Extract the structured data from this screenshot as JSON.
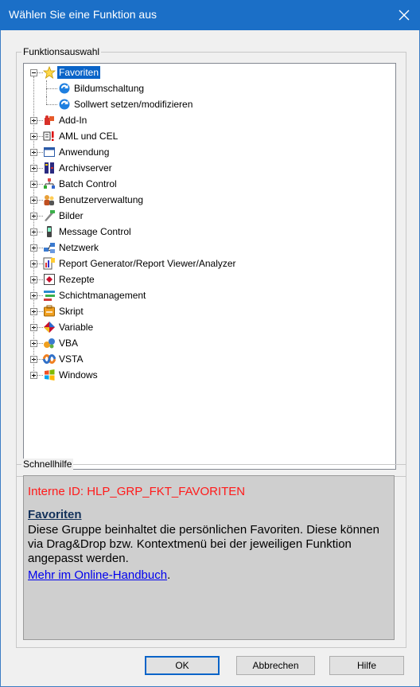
{
  "window": {
    "title": "Wählen Sie eine Funktion aus",
    "close_glyph": "✕"
  },
  "function_group": {
    "legend": "Funktionsauswahl",
    "tree": [
      {
        "label": "Favoriten",
        "icon": "star-icon",
        "expander": "minus",
        "selected": true,
        "level": 0
      },
      {
        "label": "Bildumschaltung",
        "icon": "function-icon",
        "level": 1
      },
      {
        "label": "Sollwert setzen/modifizieren",
        "icon": "function-icon",
        "level": 1
      },
      {
        "label": "Add-In",
        "icon": "puzzle-icon",
        "expander": "plus",
        "level": 0
      },
      {
        "label": "AML und CEL",
        "icon": "alarm-list-icon",
        "expander": "plus",
        "level": 0
      },
      {
        "label": "Anwendung",
        "icon": "window-icon",
        "expander": "plus",
        "level": 0
      },
      {
        "label": "Archivserver",
        "icon": "archive-server-icon",
        "expander": "plus",
        "level": 0
      },
      {
        "label": "Batch Control",
        "icon": "batch-control-icon",
        "expander": "plus",
        "level": 0
      },
      {
        "label": "Benutzerverwaltung",
        "icon": "users-icon",
        "expander": "plus",
        "level": 0
      },
      {
        "label": "Bilder",
        "icon": "pictures-icon",
        "expander": "plus",
        "level": 0
      },
      {
        "label": "Message Control",
        "icon": "phone-icon",
        "expander": "plus",
        "level": 0
      },
      {
        "label": "Netzwerk",
        "icon": "network-icon",
        "expander": "plus",
        "level": 0
      },
      {
        "label": "Report Generator/Report Viewer/Analyzer",
        "icon": "report-icon",
        "expander": "plus",
        "level": 0
      },
      {
        "label": "Rezepte",
        "icon": "recipe-icon",
        "expander": "plus",
        "level": 0
      },
      {
        "label": "Schichtmanagement",
        "icon": "shift-icon",
        "expander": "plus",
        "level": 0
      },
      {
        "label": "Skript",
        "icon": "script-icon",
        "expander": "plus",
        "level": 0
      },
      {
        "label": "Variable",
        "icon": "variable-icon",
        "expander": "plus",
        "level": 0
      },
      {
        "label": "VBA",
        "icon": "vba-icon",
        "expander": "plus",
        "level": 0
      },
      {
        "label": "VSTA",
        "icon": "vsta-icon",
        "expander": "plus",
        "level": 0
      },
      {
        "label": "Windows",
        "icon": "windows-icon",
        "expander": "plus",
        "level": 0
      }
    ]
  },
  "quick_help": {
    "legend": "Schnellhilfe",
    "internal_id": "Interne ID: HLP_GRP_FKT_FAVORITEN",
    "title": "Favoriten",
    "text": "Diese Gruppe beinhaltet die persönlichen Favoriten. Diese können via Drag&Drop bzw. Kontextmenü bei der jeweiligen Funktion angepasst werden.",
    "link": "Mehr im Online-Handbuch",
    "link_suffix": "."
  },
  "buttons": {
    "ok": "OK",
    "cancel": "Abbrechen",
    "help": "Hilfe"
  },
  "colors": {
    "titlebar": "#1b6fc7",
    "selection": "#0a64c8",
    "help_id": "#ff1a1a",
    "link": "#0000ee"
  }
}
